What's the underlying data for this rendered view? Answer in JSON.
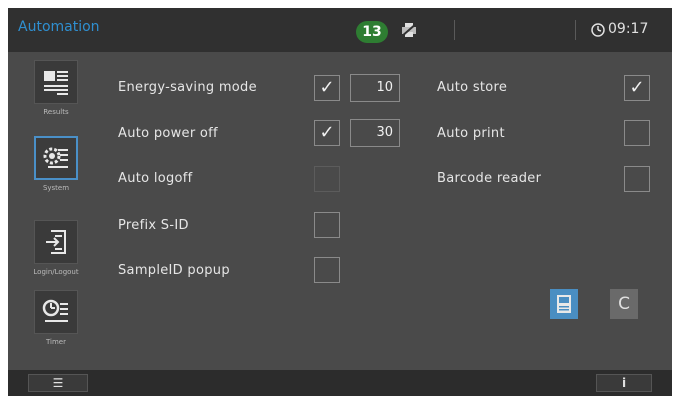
{
  "header": {
    "title": "Automation",
    "notification_count": "13",
    "time": "09:17"
  },
  "sidebar": {
    "items": [
      {
        "label": "Results",
        "icon": "results-list-icon"
      },
      {
        "label": "System",
        "icon": "system-settings-icon",
        "active": true
      },
      {
        "label": "Login/Logout",
        "icon": "login-logout-icon"
      },
      {
        "label": "Timer",
        "icon": "timer-icon"
      }
    ]
  },
  "settings_left": [
    {
      "label": "Energy-saving mode",
      "checked": true,
      "value": "10"
    },
    {
      "label": "Auto power off",
      "checked": true,
      "value": "30"
    },
    {
      "label": "Auto logoff",
      "checked": false
    },
    {
      "label": "Prefix S-ID",
      "checked": false
    },
    {
      "label": "SampleID popup",
      "checked": false
    }
  ],
  "settings_right": [
    {
      "label": "Auto store",
      "checked": true
    },
    {
      "label": "Auto print",
      "checked": false
    },
    {
      "label": "Barcode reader",
      "checked": false
    }
  ],
  "actions": {
    "cancel_label": "C",
    "save_icon": "save-icon"
  },
  "footer": {
    "menu_icon": "menu-icon",
    "info_label": "i"
  },
  "colors": {
    "accent": "#2f8fd0",
    "badge": "#2e7d32",
    "background": "#4a4a4a",
    "topbar": "#303030"
  }
}
